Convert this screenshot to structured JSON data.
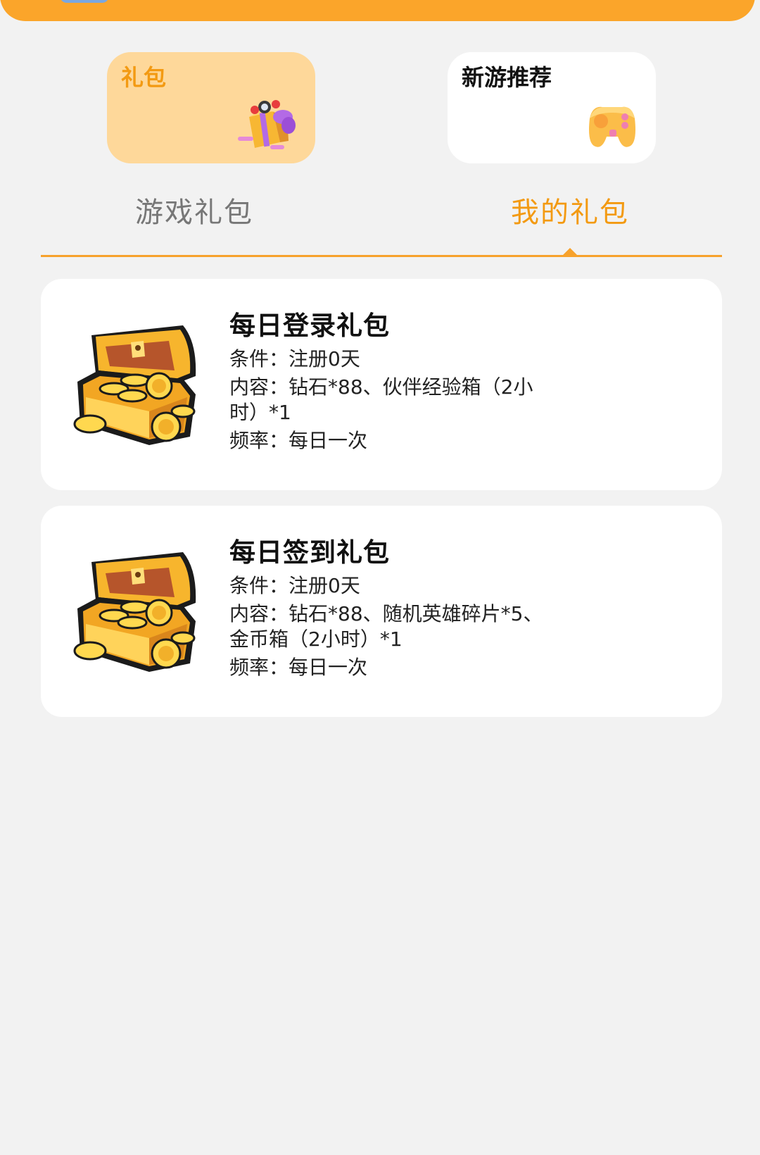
{
  "top_cards": {
    "gift": {
      "title": "礼包"
    },
    "new_game": {
      "title": "新游推荐"
    }
  },
  "tabs": [
    {
      "label": "游戏礼包",
      "active": false
    },
    {
      "label": "我的礼包",
      "active": true
    }
  ],
  "gifts": [
    {
      "name": "每日登录礼包",
      "condition_label": "条件：",
      "condition": "注册0天",
      "content_label": "内容：",
      "content": "钻石*88、伙伴经验箱（2小时）*1",
      "frequency_label": "频率：",
      "frequency": "每日一次"
    },
    {
      "name": "每日签到礼包",
      "condition_label": "条件：",
      "condition": "注册0天",
      "content_label": "内容：",
      "content": "钻石*88、随机英雄碎片*5、金币箱（2小时）*1",
      "frequency_label": "频率：",
      "frequency": "每日一次"
    }
  ],
  "colors": {
    "accent": "#f39a12",
    "header": "#fba52a",
    "gift_card_bg": "#fed89a",
    "page_bg": "#f2f2f2"
  },
  "icons": {
    "gift_card": "gift-box-icon",
    "new_game_card": "gamepad-icon",
    "gift_item": "treasure-chest-icon"
  }
}
